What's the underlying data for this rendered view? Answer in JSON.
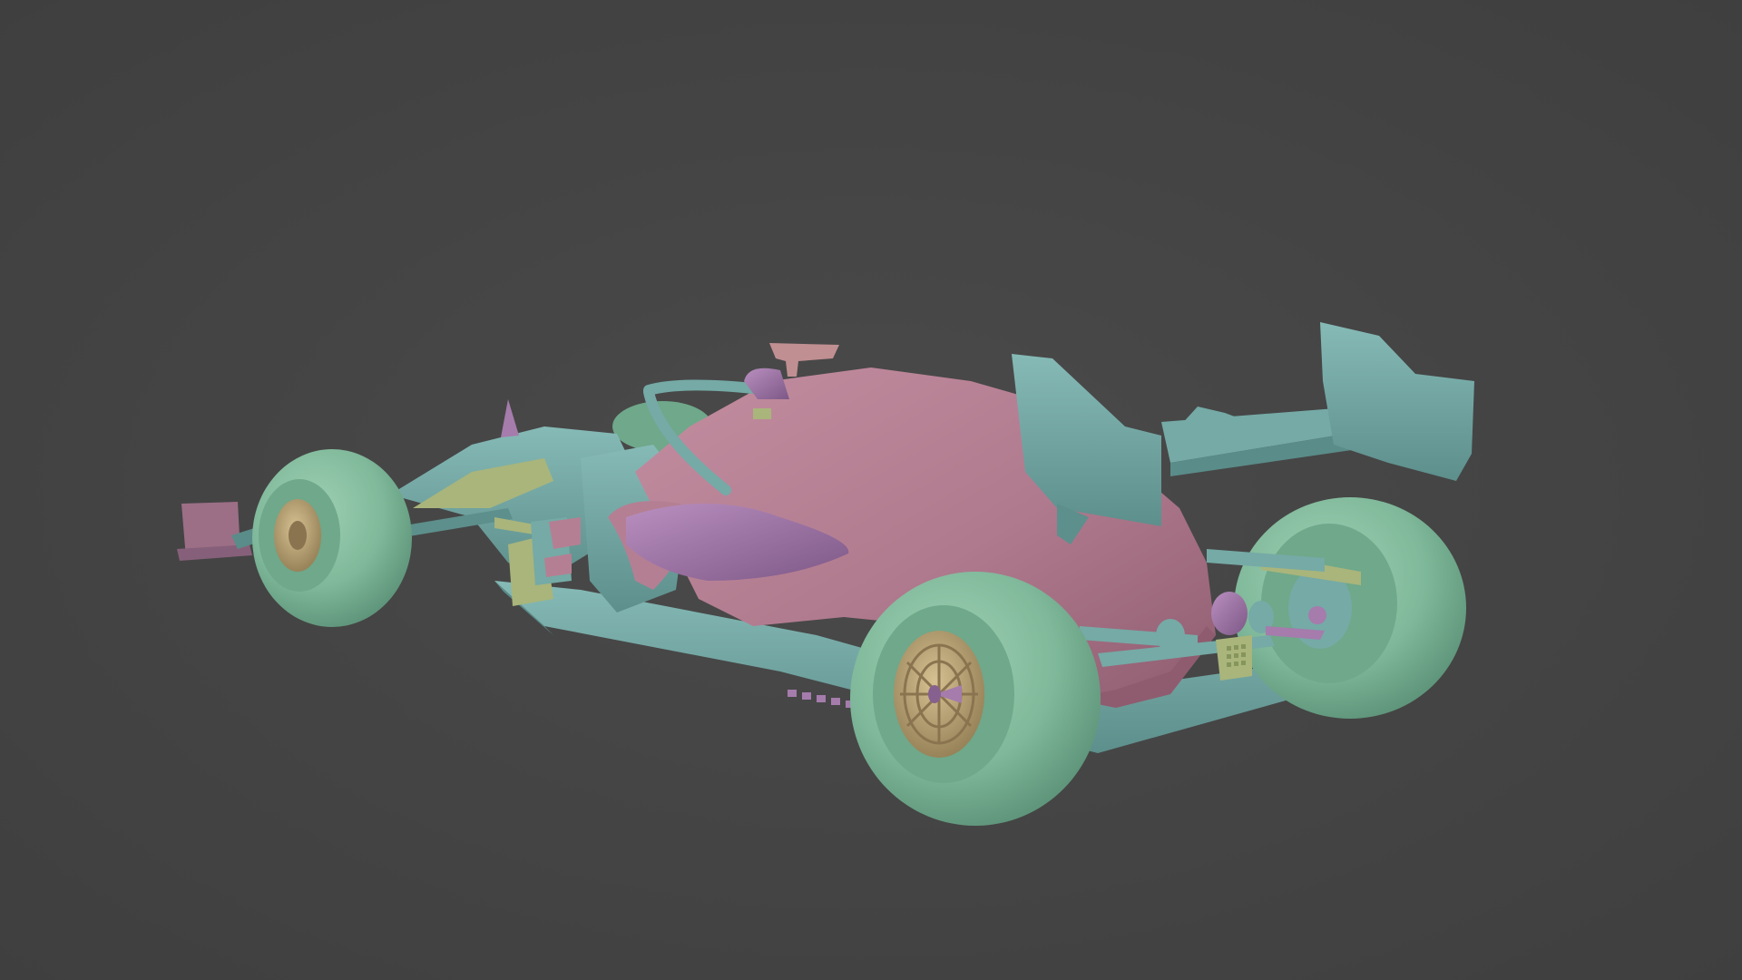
{
  "viewport": {
    "background_color": "#444444"
  },
  "model": {
    "subject": "formula-one-car",
    "material_colors": {
      "tyre": "#7fb89a",
      "tyre_shadow": "#5f9a7d",
      "rim": "#bda67a",
      "rim_shadow": "#9a855c",
      "body_pink": "#b57f93",
      "body_pink_shadow": "#956374",
      "body_teal": "#75aaa6",
      "body_teal_shadow": "#5a8c89",
      "accent_purple": "#a57cac",
      "accent_purple_shadow": "#86608e",
      "accent_olive": "#a9b57b",
      "accent_mauve": "#9c6f86"
    }
  }
}
